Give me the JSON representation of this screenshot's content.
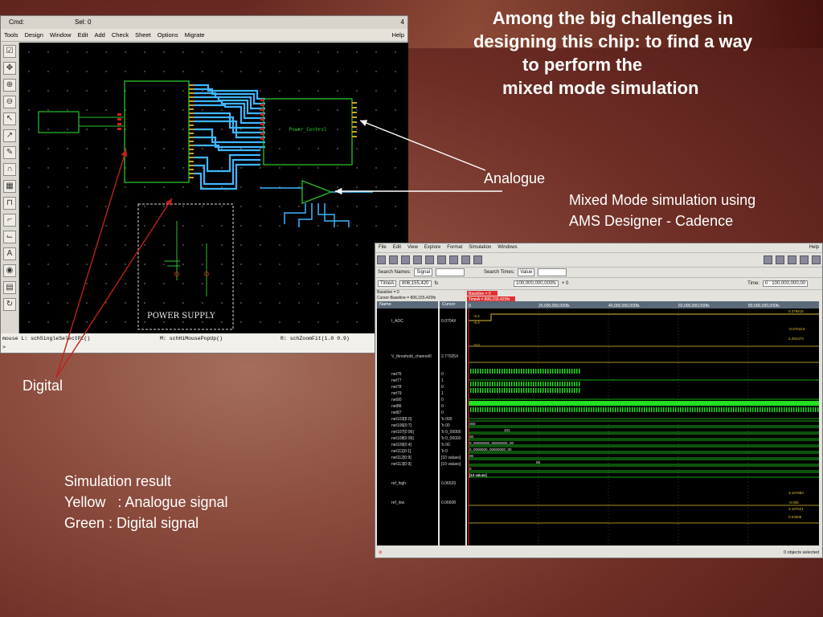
{
  "slide": {
    "title_lines": [
      "Among the big challenges in",
      "designing this chip: to find a way",
      "to perform the",
      "mixed mode simulation"
    ],
    "analogue_label": "Analogue",
    "mixed_mode_lines": [
      "Mixed Mode simulation using",
      "AMS Designer - Cadence"
    ],
    "digital_label": "Digital",
    "sim_result_lines": [
      "Simulation result",
      "Yellow   : Analogue signal",
      "Green : Digital signal"
    ]
  },
  "schematic": {
    "cmd_label": "Cmd:",
    "sel_label": "Sel: 0",
    "window_num": "4",
    "menu": [
      "Tools",
      "Design",
      "Window",
      "Edit",
      "Add",
      "Check",
      "Sheet",
      "Options",
      "Migrate"
    ],
    "help": "Help",
    "tool_icons": [
      "checkbox-icon",
      "crosshair-icon",
      "zoom-in-icon",
      "zoom-out-icon",
      "select-arrow-icon",
      "select-arrow-icon",
      "pencil-icon",
      "wire-icon",
      "grid-icon",
      "wire-icon",
      "bend-icon",
      "bend-icon",
      "label-icon",
      "eye-icon",
      "sheet-icon",
      "refresh-icon"
    ],
    "power_control_label": "Power_Control",
    "power_supply_label": "POWER SUPPLY",
    "status_left": "mouse L: schSingleSelectPt()",
    "status_mid": "M: schHiMousePopUp()",
    "status_right": "R: schZoomFit(1.0 0.9)",
    "prompt": ">"
  },
  "waveform": {
    "menu": [
      "File",
      "Edit",
      "View",
      "Explore",
      "Format",
      "Simulation",
      "Windows"
    ],
    "help": "Help",
    "search_names_label": "Search Names:",
    "search_names_value": "Signal",
    "search_times_label": "Search Times:",
    "search_times_value": "Value",
    "time_a_label": "TimeA",
    "time_a_value": "806,155,420",
    "time_a_unit": "fs",
    "zoom_value": "100,000,000,000fs",
    "plus_zero": "+ 0",
    "time_label": "Time:",
    "time_range": "0 : 100,000,000,00",
    "baseline_label": "Baseline = 0",
    "cursor_baseline": "Cursor-Baseline = 806,155,420fs",
    "name_col": "Name",
    "cursor_col": "Cursor",
    "baseline_marker": "Baseline = 0",
    "timea_marker": "TimeA = 806,155,420fs",
    "ruler_ticks": [
      "0",
      "20,000,000,000fs",
      "40,000,000,000fs",
      "60,000,000,000fs",
      "80,000,000,000fs"
    ],
    "signals": [
      {
        "name": "I_ADC",
        "cursor": "0.0704X"
      },
      {
        "name": "V_threshold_channel0",
        "cursor": "2.77025X"
      },
      {
        "name": "net76",
        "cursor": "0"
      },
      {
        "name": "net77",
        "cursor": "1"
      },
      {
        "name": "net78",
        "cursor": "0"
      },
      {
        "name": "net79",
        "cursor": "1"
      },
      {
        "name": "net90",
        "cursor": "0"
      },
      {
        "name": "net86",
        "cursor": "0"
      },
      {
        "name": "net87",
        "cursor": "0"
      },
      {
        "name": "net103[8:0]",
        "cursor": "'b 000"
      },
      {
        "name": "net106[0:7]",
        "cursor": "'b 00"
      },
      {
        "name": "net107[0:96]",
        "cursor": "'b 0_00000"
      },
      {
        "name": "net108[0:96]",
        "cursor": "'b 0_00000"
      },
      {
        "name": "net109[0:4]",
        "cursor": "'b 00"
      },
      {
        "name": "net111[0:1]",
        "cursor": "'b 0"
      },
      {
        "name": "net112[0:9]",
        "cursor": "[10 values]"
      },
      {
        "name": "net113[0:9]",
        "cursor": "[10 values]"
      },
      {
        "name": "ref_high",
        "cursor": "0.06529"
      },
      {
        "name": "ref_low",
        "cursor": "0.06608"
      }
    ],
    "bus_values": [
      "000",
      "101",
      "00",
      "0_00000000_00000000_00",
      "0_0000000_00000000_00",
      "00",
      "06",
      "0",
      "[10 values]",
      "[10 values]"
    ],
    "analog_labels": [
      "0.376615",
      "-0.2",
      "-0.4",
      "-0.570413",
      "2.291373",
      "-0.0",
      "3.167883",
      "-0.005",
      "3.197521",
      "0.04505"
    ],
    "objects_selected": "0 objects selected"
  }
}
